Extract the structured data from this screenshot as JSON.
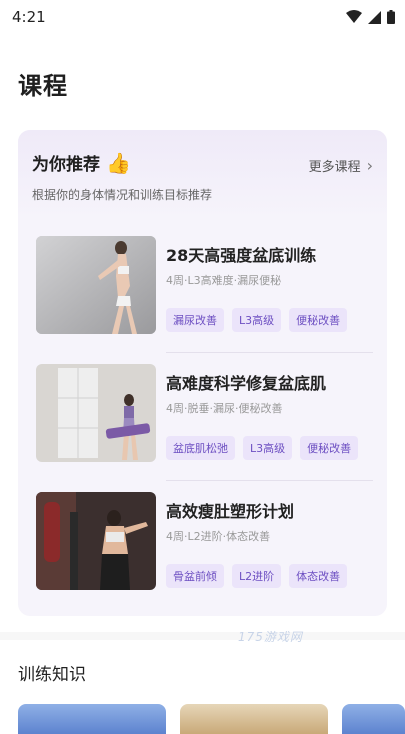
{
  "status": {
    "time": "4:21"
  },
  "page": {
    "title": "课程"
  },
  "recommend": {
    "title": "为你推荐",
    "subtitle": "根据你的身体情况和训练目标推荐",
    "more_label": "更多课程"
  },
  "courses": [
    {
      "name": "28天高强度盆底训练",
      "meta": "4周·L3高难度·漏尿便秘",
      "tags": [
        "漏尿改善",
        "L3高级",
        "便秘改善"
      ]
    },
    {
      "name": "高难度科学修复盆底肌",
      "meta": "4周·脱垂·漏尿·便秘改善",
      "tags": [
        "盆底肌松弛",
        "L3高级",
        "便秘改善"
      ]
    },
    {
      "name": "高效瘦肚塑形计划",
      "meta": "4周·L2进阶·体态改善",
      "tags": [
        "骨盆前倾",
        "L2进阶",
        "体态改善"
      ]
    }
  ],
  "knowledge": {
    "title": "训练知识"
  },
  "watermark": "175游戏网",
  "colors": {
    "accent": "#6d4fc2",
    "tag_bg": "#ebe4fa",
    "card_bg": "#f6f4fb"
  }
}
